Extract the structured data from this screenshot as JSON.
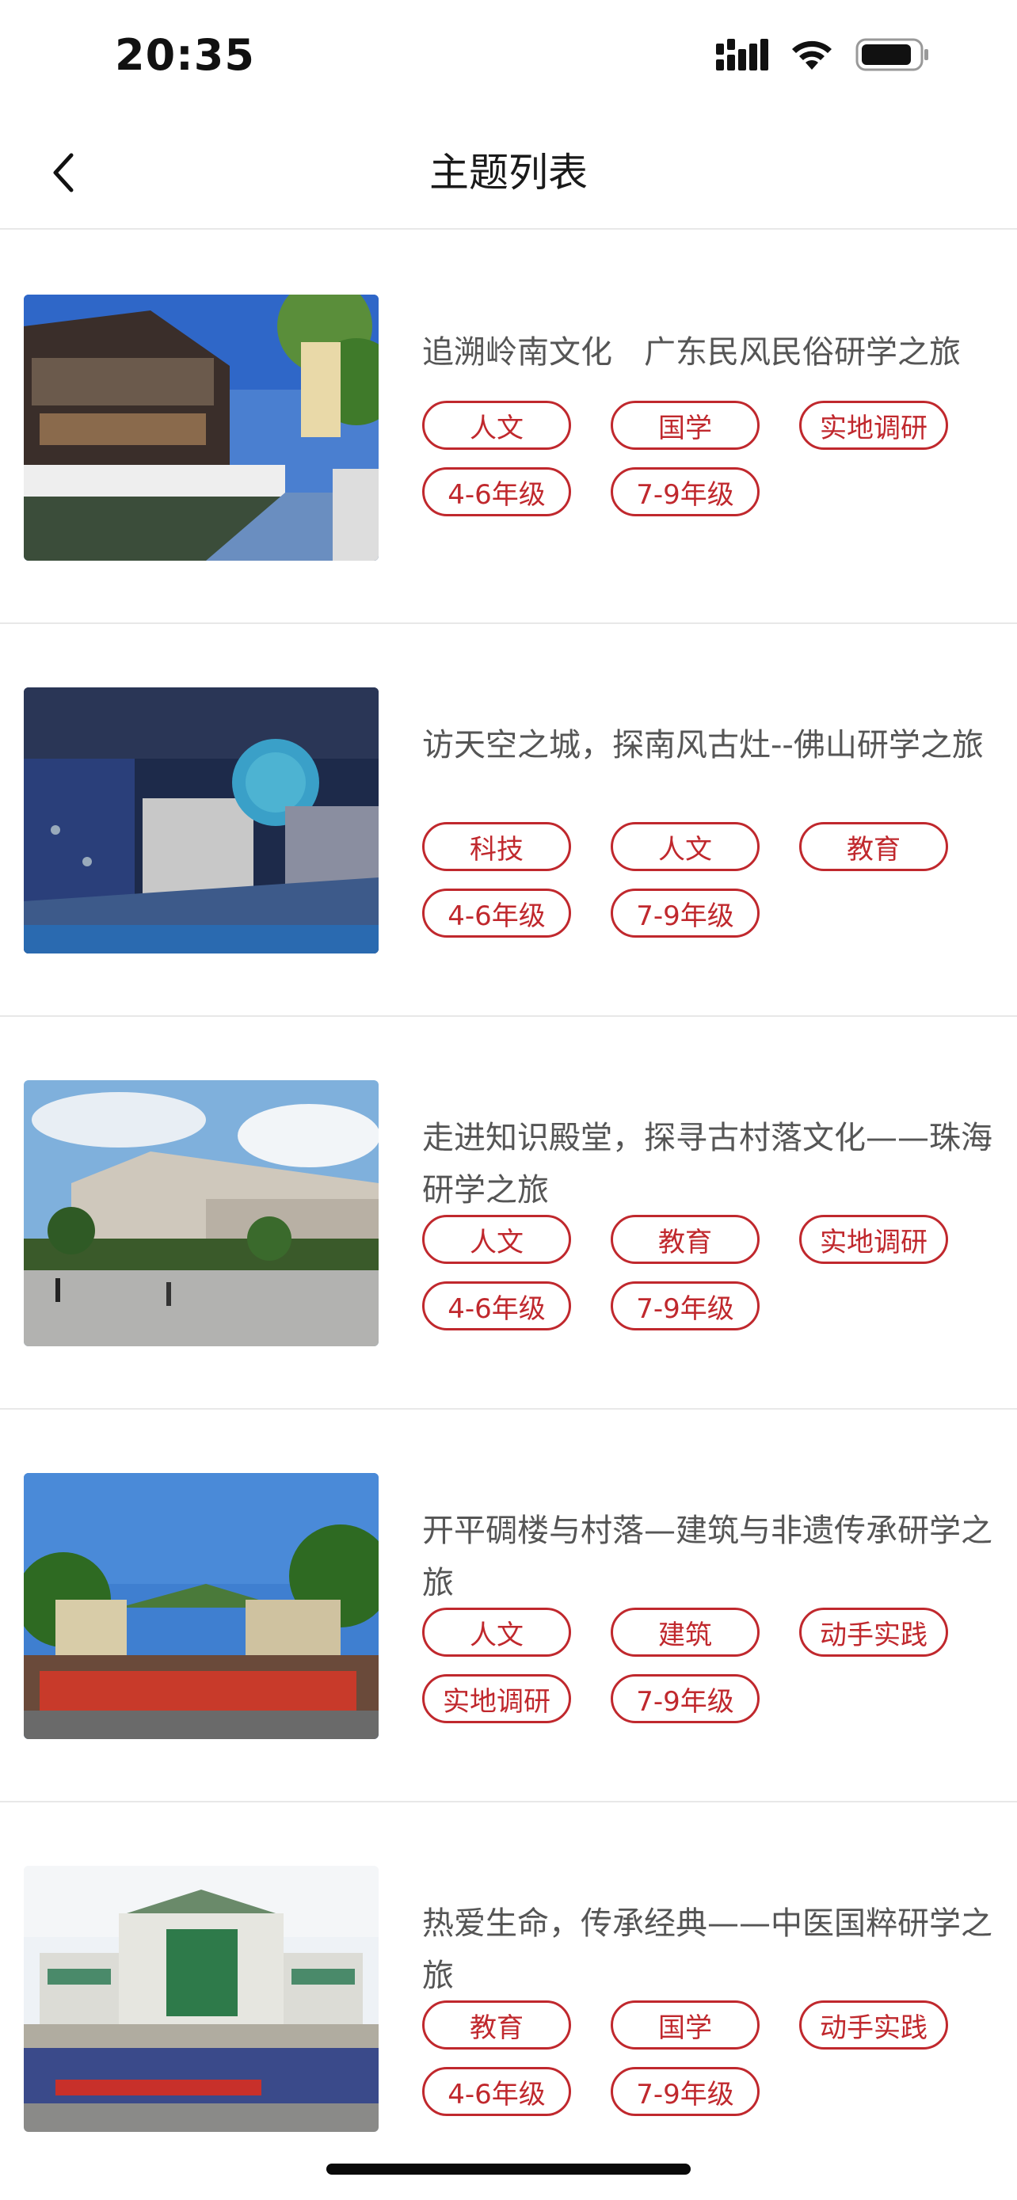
{
  "status_bar": {
    "time": "20:35"
  },
  "nav": {
    "title": "主题列表"
  },
  "topics": [
    {
      "title": "追溯岭南文化　广东民风民俗研学之旅",
      "tags": [
        "人文",
        "国学",
        "实地调研",
        "4-6年级",
        "7-9年级"
      ]
    },
    {
      "title": "访天空之城，探南风古灶--佛山研学之旅",
      "tags": [
        "科技",
        "人文",
        "教育",
        "4-6年级",
        "7-9年级"
      ]
    },
    {
      "title": "走进知识殿堂，探寻古村落文化——珠海研学之旅",
      "tags": [
        "人文",
        "教育",
        "实地调研",
        "4-6年级",
        "7-9年级"
      ]
    },
    {
      "title": "开平碉楼与村落—建筑与非遗传承研学之旅",
      "tags": [
        "人文",
        "建筑",
        "动手实践",
        "实地调研",
        "7-9年级"
      ]
    },
    {
      "title": "热爱生命，传承经典——中医国粹研学之旅",
      "tags": [
        "教育",
        "国学",
        "动手实践",
        "4-6年级",
        "7-9年级"
      ]
    }
  ],
  "colors": {
    "accent": "#c0282d",
    "title_text": "#555555",
    "divider": "#e8e8e8"
  }
}
